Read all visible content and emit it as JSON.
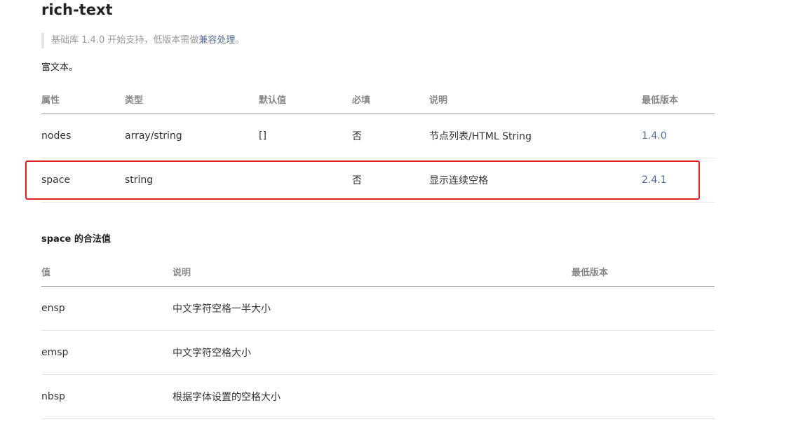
{
  "title": "rich-text",
  "note": {
    "text": "基础库 1.4.0 开始支持，低版本需做",
    "link": "兼容处理",
    "suffix": "。"
  },
  "description": "富文本。",
  "properties_table": {
    "headers": [
      "属性",
      "类型",
      "默认值",
      "必填",
      "说明",
      "最低版本"
    ],
    "rows": [
      [
        "nodes",
        "array/string",
        "[]",
        "否",
        "节点列表/HTML String",
        "1.4.0"
      ],
      [
        "space",
        "string",
        "",
        "否",
        "显示连续空格",
        "2.4.1"
      ]
    ]
  },
  "space_section": {
    "title": "space 的合法值",
    "headers": [
      "值",
      "说明",
      "最低版本"
    ],
    "rows": [
      [
        "ensp",
        "中文字符空格一半大小",
        ""
      ],
      [
        "emsp",
        "中文字符空格大小",
        ""
      ],
      [
        "nbsp",
        "根据字体设置的空格大小",
        ""
      ]
    ]
  },
  "colors": {
    "link": "#576b95",
    "highlight": "#e02020"
  }
}
